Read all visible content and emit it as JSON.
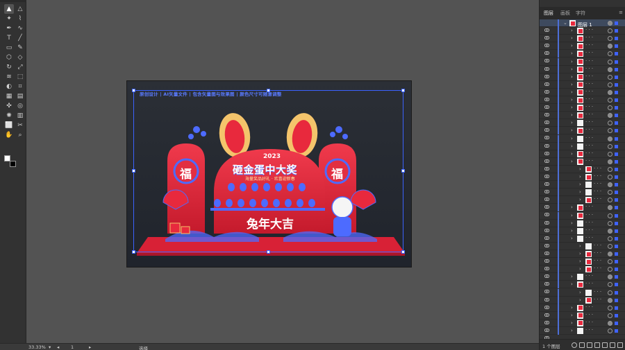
{
  "panel": {
    "tabs": [
      "图层",
      "画板",
      "字符"
    ],
    "top_layer_name": "图层 1",
    "layer_count_label": "1 个图层"
  },
  "status": {
    "zoom": "33.33%",
    "artboard_index": "1",
    "tool_label": "选择"
  },
  "artwork": {
    "promo_text": "原创设计 | AI矢量文件 | 包含矢量图与效果图 | 颜色尺寸可随意调整",
    "year": "2023",
    "title": "砸金蛋中大奖",
    "subtitle": "海量奖品好礼 · 欢喜迎新春",
    "bottom_text": "兔年大吉",
    "fu_char": "福"
  },
  "colors": {
    "accent": "#3f63ff",
    "red": "#e8293d",
    "blue": "#4d6bff",
    "gold": "#f4c46b"
  }
}
